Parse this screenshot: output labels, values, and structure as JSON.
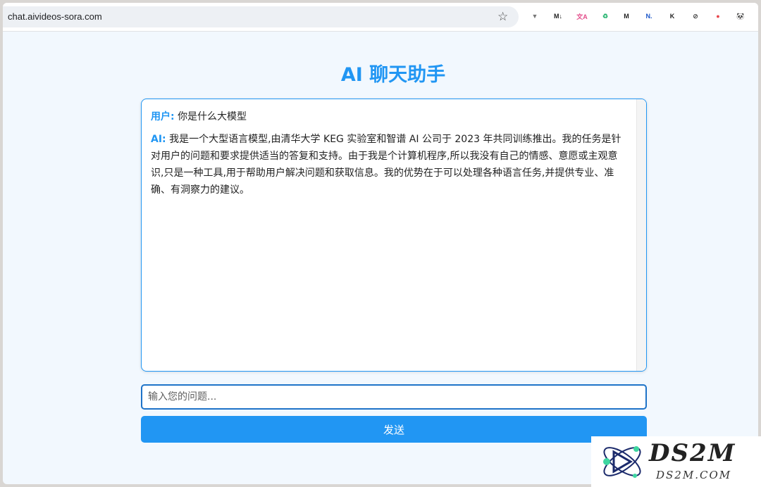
{
  "browser": {
    "url": "chat.aivideos-sora.com",
    "extensions": [
      {
        "icon": "vee-extension-icon",
        "text": "▼",
        "color": "#777"
      },
      {
        "icon": "markdown-extension-icon",
        "text": "M↓",
        "color": "#222"
      },
      {
        "icon": "translate-extension-icon",
        "text": "文A",
        "color": "#e34c8a"
      },
      {
        "icon": "green-leaf-extension-icon",
        "text": "♻",
        "color": "#2bb673"
      },
      {
        "icon": "md-dark-extension-icon",
        "text": "M",
        "color": "#222"
      },
      {
        "icon": "n-extension-icon",
        "text": "N.",
        "color": "#1a56c9"
      },
      {
        "icon": "k-extension-icon",
        "text": "K",
        "color": "#222"
      },
      {
        "icon": "eye-off-extension-icon",
        "text": "⊘",
        "color": "#555"
      },
      {
        "icon": "red-circle-extension-icon",
        "text": "●",
        "color": "#e8464b"
      },
      {
        "icon": "panda-extension-icon",
        "text": "🐼",
        "color": "#333"
      }
    ]
  },
  "page": {
    "title": "AI 聊天助手"
  },
  "chat": {
    "messages": [
      {
        "sender": "用户:",
        "text": "你是什么大模型"
      },
      {
        "sender": "AI:",
        "text": "我是一个大型语言模型,由清华大学 KEG 实验室和智谱 AI 公司于 2023 年共同训练推出。我的任务是针对用户的问题和要求提供适当的答复和支持。由于我是个计算机程序,所以我没有自己的情感、意愿或主观意识,只是一种工具,用于帮助用户解决问题和获取信息。我的优势在于可以处理各种语言任务,并提供专业、准确、有洞察力的建议。"
      }
    ]
  },
  "input": {
    "placeholder": "输入您的问题...",
    "value": ""
  },
  "send_button": {
    "label": "发送"
  },
  "watermark": {
    "brand": "DS2M",
    "domain": "DS2M.COM"
  },
  "colors": {
    "accent": "#2196f3",
    "page_bg": "#f2f8fe"
  }
}
